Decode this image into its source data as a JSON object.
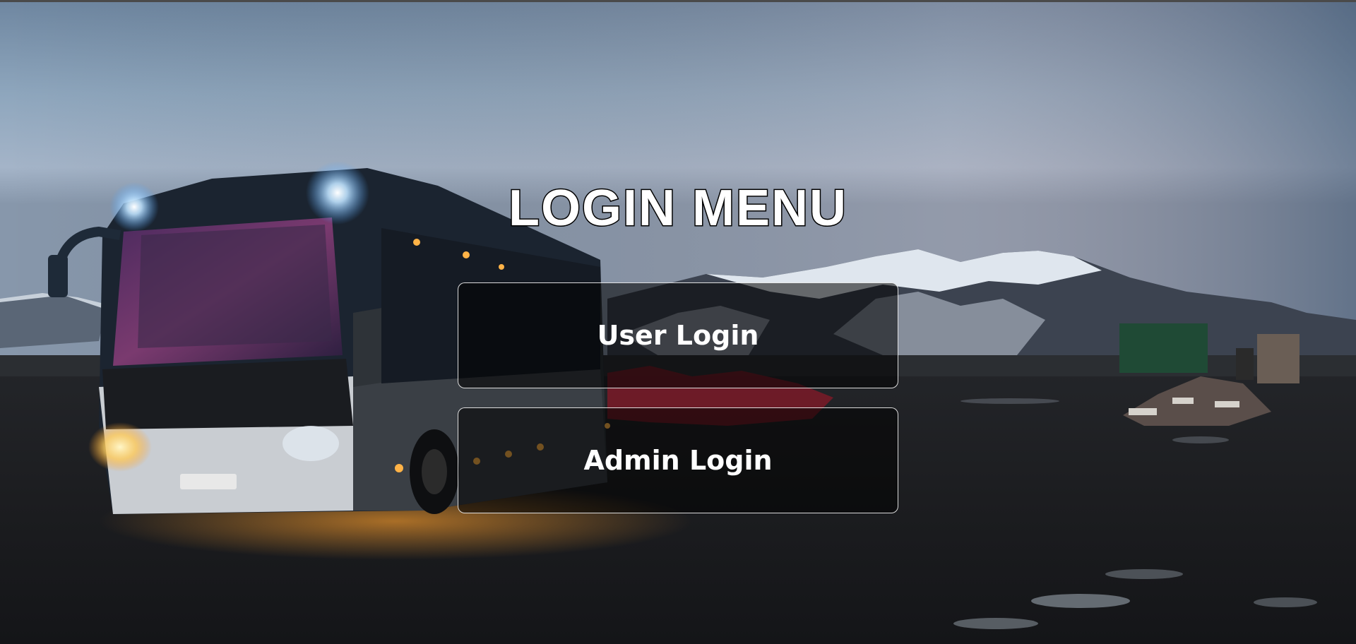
{
  "page": {
    "title": "LOGIN MENU"
  },
  "buttons": {
    "user_login": "User Login",
    "admin_login": "Admin Login"
  },
  "background": {
    "description_icon": "bus-mountains-photo"
  },
  "colors": {
    "title_fill": "#ffffff",
    "title_stroke": "#000000",
    "button_border": "#ffffff",
    "button_text": "#ffffff"
  }
}
